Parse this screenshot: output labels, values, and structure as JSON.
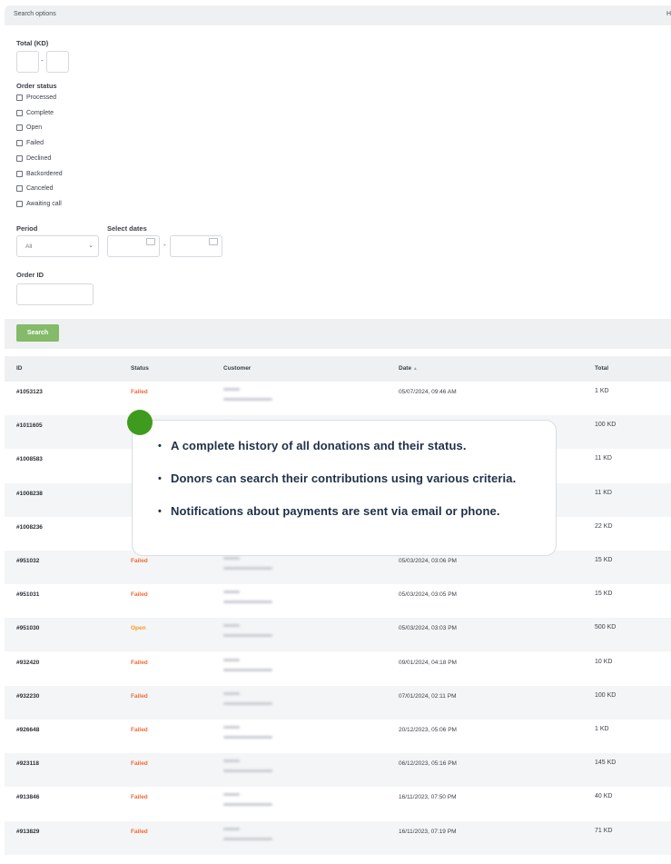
{
  "search_panel": {
    "title": "Search options",
    "hide_label": "H",
    "total_label": "Total (KD)",
    "range_dash": "-",
    "order_status_label": "Order status",
    "statuses": [
      "Processed",
      "Complete",
      "Open",
      "Failed",
      "Declined",
      "Backordered",
      "Canceled",
      "Awaiting call"
    ],
    "period_label": "Period",
    "period_value": "All",
    "select_dates_label": "Select dates",
    "order_id_label": "Order ID",
    "search_button": "Search"
  },
  "table": {
    "headers": {
      "id": "ID",
      "status": "Status",
      "customer": "Customer",
      "date": "Date",
      "sort": "▲",
      "total": "Total"
    },
    "rows": [
      {
        "id": "#1053123",
        "status": "Failed",
        "date": "05/07/2024, 09:46 AM",
        "total": "1 KD"
      },
      {
        "id": "#1011605",
        "status": "",
        "date": "",
        "total": "100 KD"
      },
      {
        "id": "#1008583",
        "status": "",
        "date": "",
        "total": "11 KD"
      },
      {
        "id": "#1008238",
        "status": "",
        "date": "",
        "total": "11 KD"
      },
      {
        "id": "#1008236",
        "status": "",
        "date": "",
        "total": "22 KD"
      },
      {
        "id": "#951032",
        "status": "Failed",
        "date": "05/03/2024, 03:06 PM",
        "total": "15 KD"
      },
      {
        "id": "#951031",
        "status": "Failed",
        "date": "05/03/2024, 03:05 PM",
        "total": "15 KD"
      },
      {
        "id": "#951030",
        "status": "Open",
        "date": "05/03/2024, 03:03 PM",
        "total": "500 KD"
      },
      {
        "id": "#932420",
        "status": "Failed",
        "date": "09/01/2024, 04:18 PM",
        "total": "10 KD"
      },
      {
        "id": "#932230",
        "status": "Failed",
        "date": "07/01/2024, 02:11 PM",
        "total": "100 KD"
      },
      {
        "id": "#926648",
        "status": "Failed",
        "date": "20/12/2023, 05:06 PM",
        "total": "1 KD"
      },
      {
        "id": "#923118",
        "status": "Failed",
        "date": "06/12/2023, 05:16 PM",
        "total": "145 KD"
      },
      {
        "id": "#913846",
        "status": "Failed",
        "date": "16/11/2023, 07:50 PM",
        "total": "40 KD"
      },
      {
        "id": "#913829",
        "status": "Failed",
        "date": "16/11/2023, 07:19 PM",
        "total": "71 KD"
      }
    ]
  },
  "callout": {
    "bullets": [
      "A complete history of all donations and their status.",
      "Donors can search their contributions using various criteria.",
      "Notifications about payments are sent via email or phone."
    ]
  },
  "colors": {
    "failed": "#f06a38",
    "open": "#f39a25",
    "accent": "#3f9b1e",
    "button": "#84ba6a"
  }
}
